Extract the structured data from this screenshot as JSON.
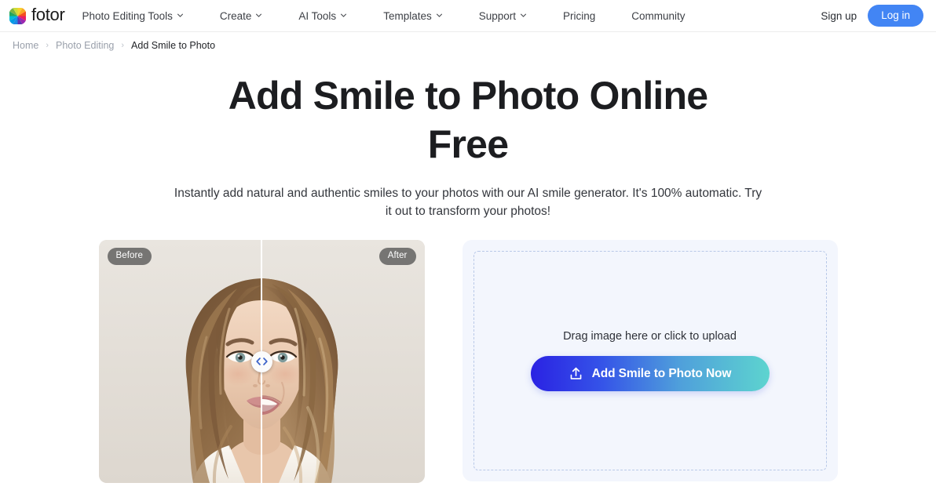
{
  "brand": {
    "name": "fotor",
    "logo_icon": "fotor-color-wheel-logo"
  },
  "nav": {
    "items": [
      {
        "label": "Photo Editing Tools",
        "has_caret": true,
        "icon": "chevron-down-icon"
      },
      {
        "label": "Create",
        "has_caret": true,
        "icon": "chevron-down-icon"
      },
      {
        "label": "AI Tools",
        "has_caret": true,
        "icon": "chevron-down-icon"
      },
      {
        "label": "Templates",
        "has_caret": true,
        "icon": "chevron-down-icon"
      },
      {
        "label": "Support",
        "has_caret": true,
        "icon": "chevron-down-icon"
      },
      {
        "label": "Pricing",
        "has_caret": false
      },
      {
        "label": "Community",
        "has_caret": false
      }
    ],
    "signup_label": "Sign up",
    "login_label": "Log in",
    "login_color": "#4285f4"
  },
  "breadcrumb": {
    "items": [
      {
        "label": "Home"
      },
      {
        "label": "Photo Editing"
      },
      {
        "label": "Add Smile to Photo"
      }
    ],
    "separator": "›"
  },
  "hero": {
    "title": "Add Smile to Photo Online Free",
    "subtitle": "Instantly add natural and authentic smiles to your photos with our AI smile generator. It's 100% automatic. Try it out to transform your photos!"
  },
  "compare": {
    "before_label": "Before",
    "after_label": "After",
    "handle_icon": "left-right-chevrons-icon",
    "handle_position_percent": 50,
    "image_alt": "Portrait of a woman, left half neutral expression, right half smiling"
  },
  "upload": {
    "drop_text": "Drag image here or click to upload",
    "cta_label": "Add Smile to Photo Now",
    "cta_icon": "upload-icon",
    "gradient_start": "#2a22e3",
    "gradient_end": "#5dd4cf",
    "panel_bg": "#f3f6fd",
    "border_color": "#b9c9e8"
  }
}
